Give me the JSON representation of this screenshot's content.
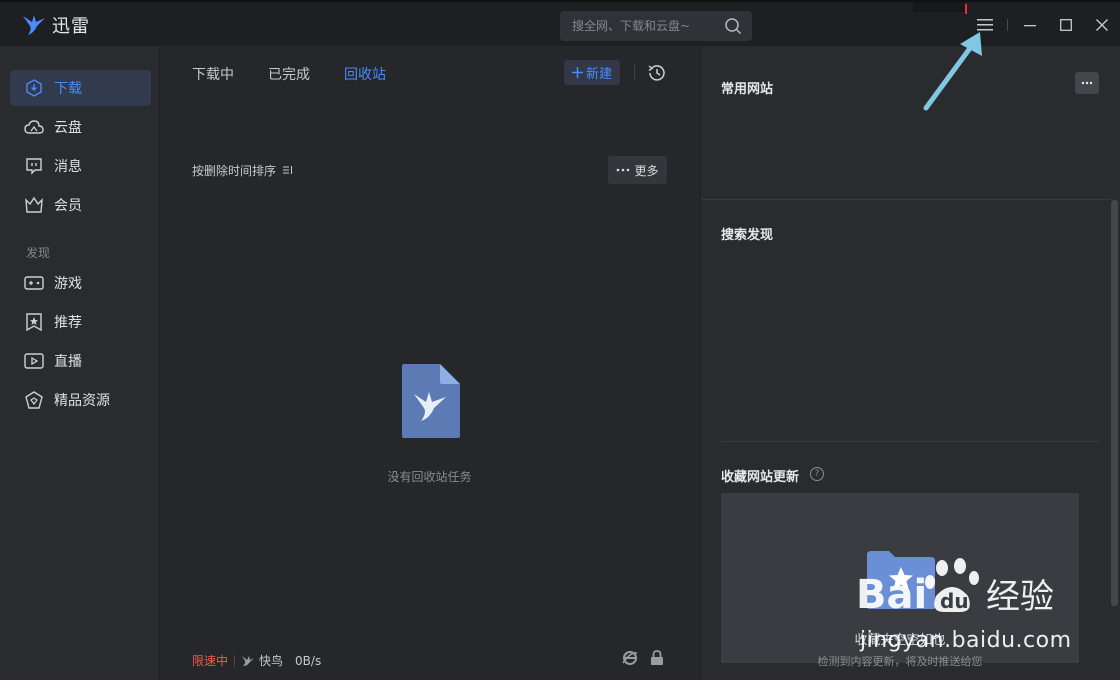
{
  "app": {
    "name": "迅雷"
  },
  "search": {
    "placeholder": "搜全网、下载和云盘~"
  },
  "sidebar": {
    "items": [
      {
        "label": "下载",
        "icon": "download-icon",
        "active": true
      },
      {
        "label": "云盘",
        "icon": "cloud-icon"
      },
      {
        "label": "消息",
        "icon": "message-icon"
      },
      {
        "label": "会员",
        "icon": "crown-icon"
      }
    ],
    "section_title": "发现",
    "discover": [
      {
        "label": "游戏",
        "icon": "gamepad-icon"
      },
      {
        "label": "推荐",
        "icon": "star-icon"
      },
      {
        "label": "直播",
        "icon": "live-icon"
      },
      {
        "label": "精品资源",
        "icon": "diamond-icon"
      }
    ]
  },
  "main": {
    "tabs": [
      {
        "label": "下载中"
      },
      {
        "label": "已完成"
      },
      {
        "label": "回收站",
        "active": true
      }
    ],
    "new_label": "新建",
    "sort_label": "按删除时间排序",
    "more_label": "更多",
    "empty_text": "没有回收站任务"
  },
  "status": {
    "limit": "限速中",
    "fast": "快鸟",
    "speed": "0B/s"
  },
  "right": {
    "common_sites": "常用网站",
    "search_discover": "搜索发现",
    "fav_updates": "收藏网站更新",
    "fav_box_text": "收藏夹空空如也",
    "fav_box_sub": "检测到内容更新，将及时推送给您"
  },
  "watermark": {
    "brand": "Baidu经验",
    "url": "jingyan.baidu.com"
  },
  "colors": {
    "accent": "#4a8bff",
    "warning": "#f15b4a",
    "annotation": "#7ec8e3"
  }
}
